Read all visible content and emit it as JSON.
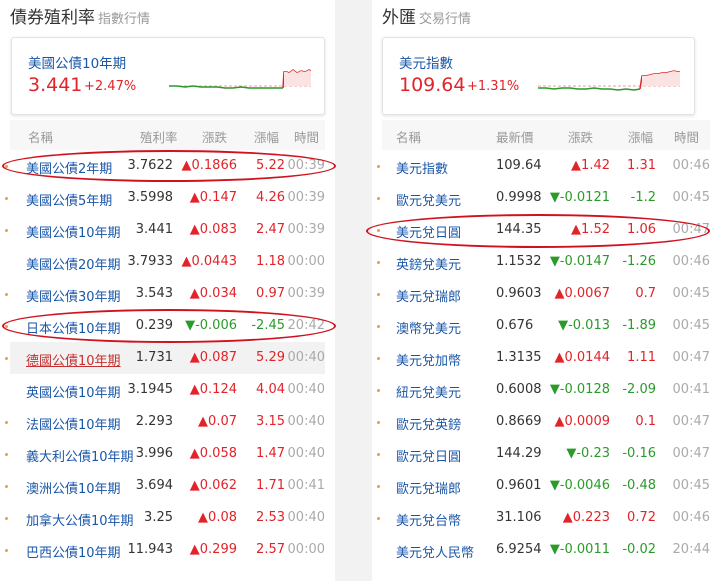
{
  "bonds": {
    "title": "債券殖利率",
    "subtitle": "指數行情",
    "featured": {
      "name": "美國公債10年期",
      "value": "3.441",
      "change": "+2.47%"
    },
    "headers": {
      "name": "名稱",
      "value": "殖利率",
      "change": "漲跌",
      "pct": "漲幅",
      "time": "時間"
    },
    "rows": [
      {
        "name": "美國公債2年期",
        "value": "3.7622",
        "change": "▲0.1866",
        "pct": "5.22",
        "time": "00:39",
        "dir": "up"
      },
      {
        "name": "美國公債5年期",
        "value": "3.5998",
        "change": "▲0.147",
        "pct": "4.26",
        "time": "00:39",
        "dir": "up"
      },
      {
        "name": "美國公債10年期",
        "value": "3.441",
        "change": "▲0.083",
        "pct": "2.47",
        "time": "00:39",
        "dir": "up"
      },
      {
        "name": "美國公債20年期",
        "value": "3.7933",
        "change": "▲0.0443",
        "pct": "1.18",
        "time": "00:00",
        "dir": "up"
      },
      {
        "name": "美國公債30年期",
        "value": "3.543",
        "change": "▲0.034",
        "pct": "0.97",
        "time": "00:39",
        "dir": "up"
      },
      {
        "name": "日本公債10年期",
        "value": "0.239",
        "change": "▼-0.006",
        "pct": "-2.45",
        "time": "20:42",
        "dir": "down"
      },
      {
        "name": "德國公債10年期",
        "value": "1.731",
        "change": "▲0.087",
        "pct": "5.29",
        "time": "00:40",
        "dir": "up"
      },
      {
        "name": "英國公債10年期",
        "value": "3.1945",
        "change": "▲0.124",
        "pct": "4.04",
        "time": "00:40",
        "dir": "up"
      },
      {
        "name": "法國公債10年期",
        "value": "2.293",
        "change": "▲0.07",
        "pct": "3.15",
        "time": "00:40",
        "dir": "up"
      },
      {
        "name": "義大利公債10年期",
        "value": "3.996",
        "change": "▲0.058",
        "pct": "1.47",
        "time": "00:40",
        "dir": "up"
      },
      {
        "name": "澳洲公債10年期",
        "value": "3.694",
        "change": "▲0.062",
        "pct": "1.71",
        "time": "00:41",
        "dir": "up"
      },
      {
        "name": "加拿大公債10年期",
        "value": "3.25",
        "change": "▲0.08",
        "pct": "2.53",
        "time": "00:40",
        "dir": "up"
      },
      {
        "name": "巴西公債10年期",
        "value": "11.943",
        "change": "▲0.299",
        "pct": "2.57",
        "time": "00:00",
        "dir": "up"
      }
    ]
  },
  "fx": {
    "title": "外匯",
    "subtitle": "交易行情",
    "featured": {
      "name": "美元指數",
      "value": "109.64",
      "change": "+1.31%"
    },
    "headers": {
      "name": "名稱",
      "value": "最新價",
      "change": "漲跌",
      "pct": "漲幅",
      "time": "時間"
    },
    "rows": [
      {
        "name": "美元指數",
        "value": "109.64",
        "change": "▲1.42",
        "pct": "1.31",
        "time": "00:46",
        "dir": "up"
      },
      {
        "name": "歐元兌美元",
        "value": "0.9998",
        "change": "▼-0.0121",
        "pct": "-1.2",
        "time": "00:45",
        "dir": "down"
      },
      {
        "name": "美元兌日圓",
        "value": "144.35",
        "change": "▲1.52",
        "pct": "1.06",
        "time": "00:47",
        "dir": "up"
      },
      {
        "name": "英鎊兌美元",
        "value": "1.1532",
        "change": "▼-0.0147",
        "pct": "-1.26",
        "time": "00:46",
        "dir": "down"
      },
      {
        "name": "美元兌瑞郎",
        "value": "0.9603",
        "change": "▲0.0067",
        "pct": "0.7",
        "time": "00:45",
        "dir": "up"
      },
      {
        "name": "澳幣兌美元",
        "value": "0.676",
        "change": "▼-0.013",
        "pct": "-1.89",
        "time": "00:45",
        "dir": "down"
      },
      {
        "name": "美元兌加幣",
        "value": "1.3135",
        "change": "▲0.0144",
        "pct": "1.11",
        "time": "00:47",
        "dir": "up"
      },
      {
        "name": "紐元兌美元",
        "value": "0.6008",
        "change": "▼-0.0128",
        "pct": "-2.09",
        "time": "00:41",
        "dir": "down"
      },
      {
        "name": "歐元兌英鎊",
        "value": "0.8669",
        "change": "▲0.0009",
        "pct": "0.1",
        "time": "00:47",
        "dir": "up"
      },
      {
        "name": "歐元兌日圓",
        "value": "144.29",
        "change": "▼-0.23",
        "pct": "-0.16",
        "time": "00:47",
        "dir": "down"
      },
      {
        "name": "歐元兌瑞郎",
        "value": "0.9601",
        "change": "▼-0.0046",
        "pct": "-0.48",
        "time": "00:45",
        "dir": "down"
      },
      {
        "name": "美元兌台幣",
        "value": "31.106",
        "change": "▲0.223",
        "pct": "0.72",
        "time": "00:46",
        "dir": "up"
      },
      {
        "name": "美元兌人民幣",
        "value": "6.9254",
        "change": "▼-0.0011",
        "pct": "-0.02",
        "time": "20:44",
        "dir": "down"
      }
    ]
  },
  "colors": {
    "up": "#e0242a",
    "down": "#2a9a2a",
    "link": "#1a57a8",
    "highlight_circle": "#d0121f"
  }
}
